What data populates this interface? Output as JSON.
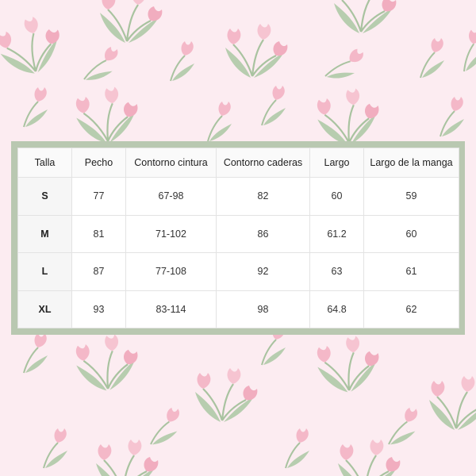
{
  "size_table": {
    "headers": [
      "Talla",
      "Pecho",
      "Contorno cintura",
      "Contorno caderas",
      "Largo",
      "Largo de la manga"
    ],
    "rows": [
      [
        "S",
        "77",
        "67-98",
        "82",
        "60",
        "59"
      ],
      [
        "M",
        "81",
        "71-102",
        "86",
        "61.2",
        "60"
      ],
      [
        "L",
        "87",
        "77-108",
        "92",
        "63",
        "61"
      ],
      [
        "XL",
        "93",
        "83-114",
        "98",
        "64.8",
        "62"
      ]
    ]
  },
  "colors": {
    "background": "#fcecf1",
    "frame": "#b9c8b1",
    "tulip_petal": "#f4b8c8",
    "tulip_leaf": "#a9c3a0"
  },
  "icons": {
    "background_pattern": "tulip-bouquet-icon"
  }
}
